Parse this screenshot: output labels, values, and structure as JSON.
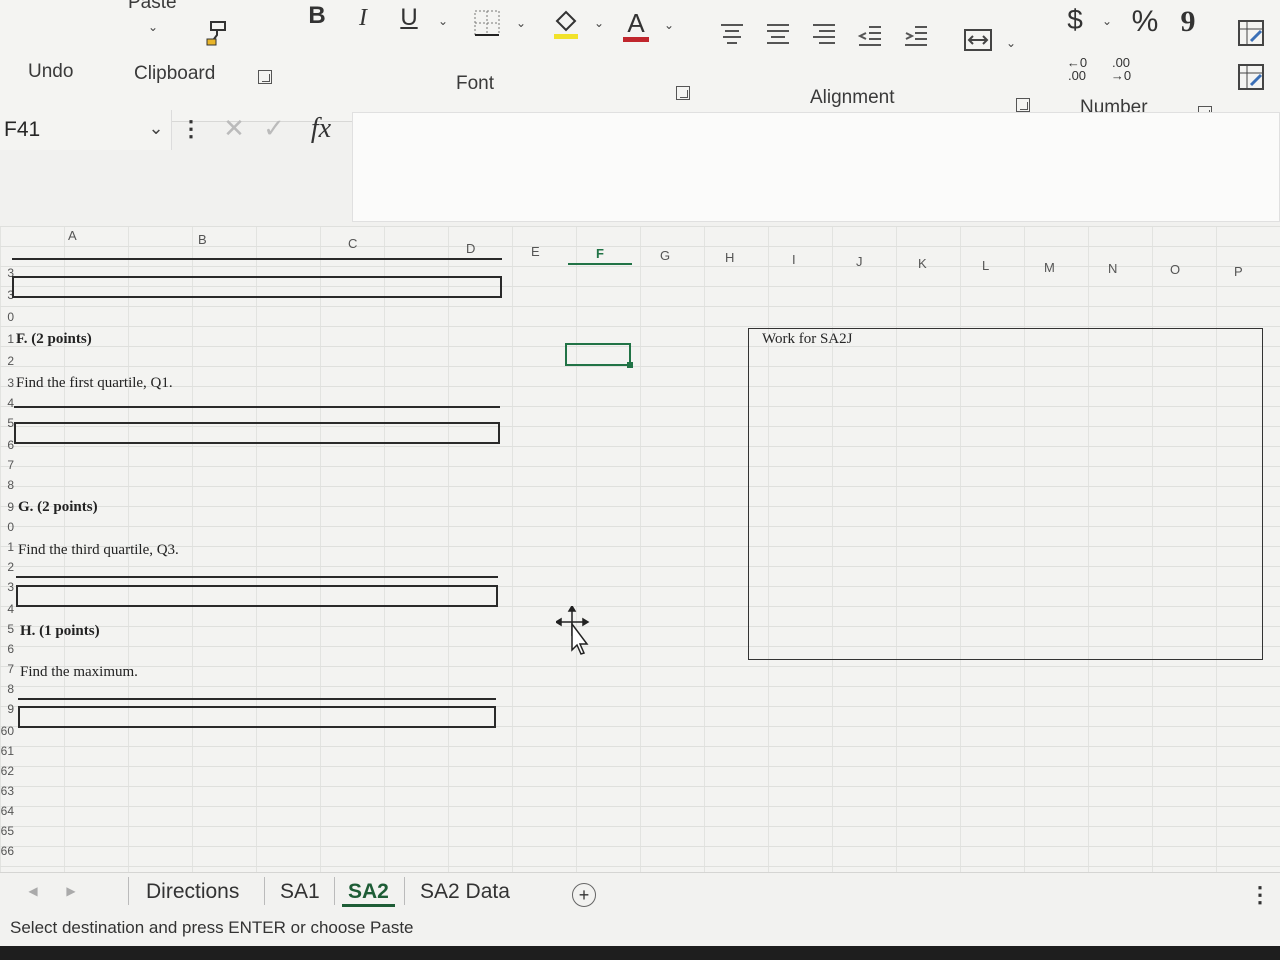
{
  "ribbon": {
    "paste_label": "Paste",
    "undo_label": "Undo",
    "clipboard_label": "Clipboard",
    "font_label": "Font",
    "alignment_label": "Alignment",
    "number_label": "Number",
    "bold": "B",
    "italic": "I",
    "underline": "U",
    "font_color_letter": "A",
    "currency": "$",
    "percent": "%",
    "comma": "9",
    "inc_decimal": "←0 .00",
    "dec_decimal": ".00 →0",
    "fx": "fx",
    "accent_color": "#217346",
    "font_color_bar": "#c0262d",
    "fill_color_bar": "#f1e22a"
  },
  "name_box": {
    "value": "F41"
  },
  "columns": [
    "A",
    "B",
    "C",
    "D",
    "E",
    "F",
    "G",
    "H",
    "I",
    "J",
    "K",
    "L",
    "M",
    "N",
    "O",
    "P"
  ],
  "rows": [
    "3",
    "3",
    "0",
    "1",
    "2",
    "3",
    "4",
    "5",
    "6",
    "7",
    "8",
    "9",
    "0",
    "1",
    "2",
    "3",
    "4",
    "5",
    "6",
    "7",
    "8",
    "9",
    "60",
    "61",
    "62",
    "63",
    "64",
    "65",
    "66"
  ],
  "sheet": {
    "f_heading": "F. (2 points)",
    "f_question": "Find the first quartile, Q1.",
    "g_heading": "G. (2 points)",
    "g_question": "Find the third quartile, Q3.",
    "h_heading": "H. (1 points)",
    "h_question": "Find the maximum.",
    "work_label": "Work for SA2J"
  },
  "tabs": {
    "items": [
      {
        "label": "Directions",
        "active": false
      },
      {
        "label": "SA1",
        "active": false
      },
      {
        "label": "SA2",
        "active": true
      },
      {
        "label": "SA2 Data",
        "active": false
      }
    ],
    "add": "+",
    "more": "⋮"
  },
  "status": {
    "message": "Select destination and press ENTER or choose Paste"
  }
}
